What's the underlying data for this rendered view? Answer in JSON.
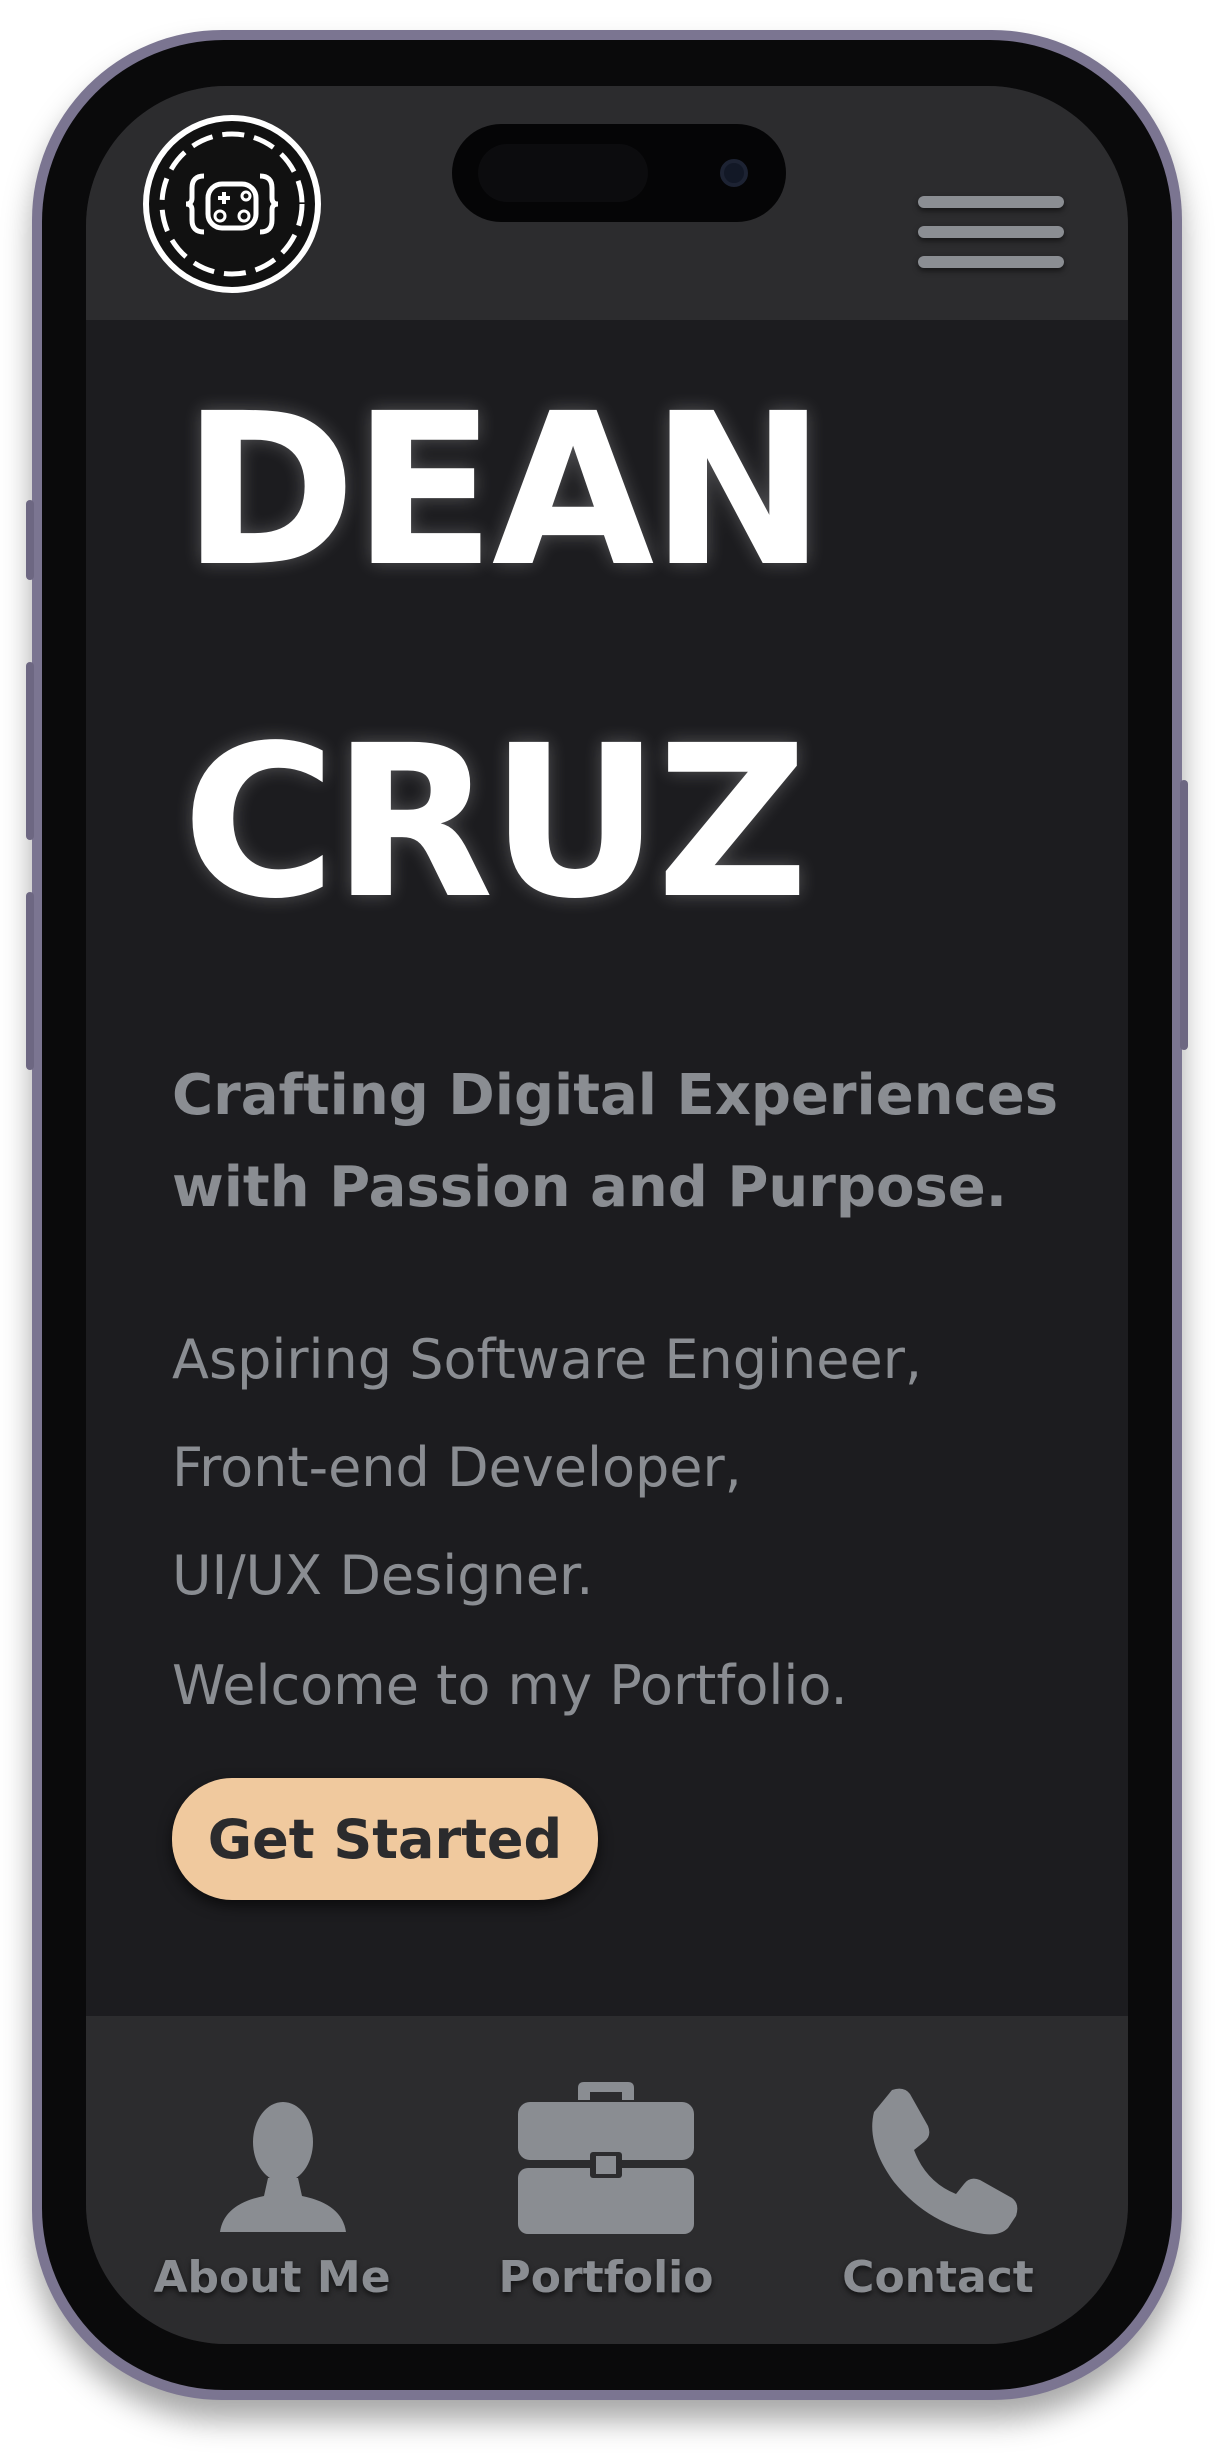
{
  "header": {
    "logo_icon": "gamepad-face-badge",
    "menu_icon": "hamburger-icon"
  },
  "hero": {
    "first_name": "DEAN",
    "last_name": "CRUZ",
    "tagline_line1": "Crafting Digital Experiences",
    "tagline_line2": "with Passion and Purpose.",
    "roles": [
      "Aspiring Software Engineer,",
      "Front-end Developer,",
      "UI/UX Designer."
    ],
    "welcome": "Welcome to my Portfolio.",
    "cta_label": "Get Started"
  },
  "bottom_nav": {
    "items": [
      {
        "label": "About Me",
        "icon": "person-icon"
      },
      {
        "label": "Portfolio",
        "icon": "briefcase-icon"
      },
      {
        "label": "Contact",
        "icon": "phone-icon"
      }
    ]
  },
  "colors": {
    "background": "#1c1c1f",
    "bar": "#2c2c2e",
    "text_muted": "#8a8d92",
    "accent": "#f0c99e",
    "frame": "#7b7591"
  }
}
